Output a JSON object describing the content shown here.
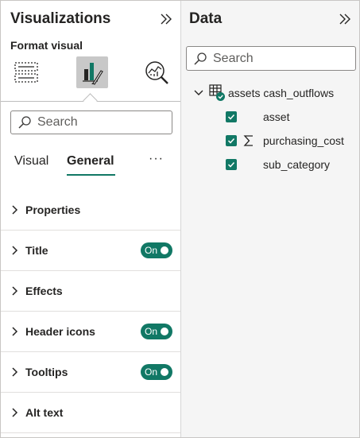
{
  "visualizations": {
    "title": "Visualizations",
    "format_label": "Format visual",
    "search": {
      "placeholder": "Search"
    },
    "tabs": [
      {
        "label": "Visual"
      },
      {
        "label": "General"
      }
    ],
    "active_tab": "General",
    "more_label": "···",
    "sections": [
      {
        "label": "Properties",
        "toggle": null
      },
      {
        "label": "Title",
        "toggle": "On"
      },
      {
        "label": "Effects",
        "toggle": null
      },
      {
        "label": "Header icons",
        "toggle": "On"
      },
      {
        "label": "Tooltips",
        "toggle": "On"
      },
      {
        "label": "Alt text",
        "toggle": null
      }
    ]
  },
  "data": {
    "title": "Data",
    "search": {
      "placeholder": "Search"
    },
    "table": {
      "name": "assets cash_outflows",
      "fields": [
        {
          "name": "asset",
          "checked": true,
          "sigma": false
        },
        {
          "name": "purchasing_cost",
          "checked": true,
          "sigma": true
        },
        {
          "name": "sub_category",
          "checked": true,
          "sigma": false
        }
      ]
    }
  },
  "colors": {
    "accent": "#117865",
    "data_pane_bg": "#f5f5f5",
    "divider": "#d6d6d6"
  },
  "icons": [
    "collapse-pane-icon",
    "add-visual-icon",
    "format-visual-icon",
    "analytics-icon",
    "search-icon",
    "chevron-right-icon",
    "chevron-down-icon",
    "table-icon",
    "checkbox-checked-icon",
    "sigma-icon"
  ]
}
